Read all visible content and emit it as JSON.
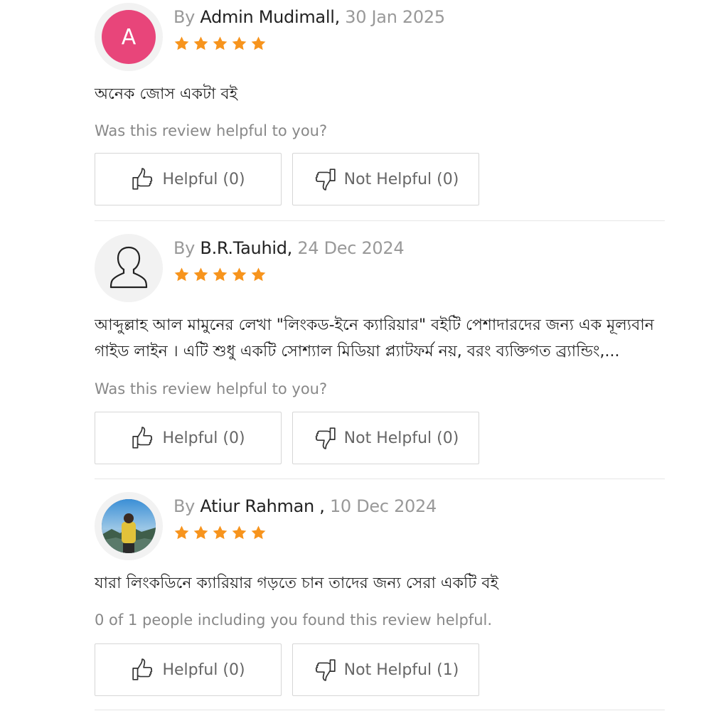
{
  "reviews": [
    {
      "by_label": "By ",
      "author": "Admin Mudimall,",
      "date": " 30 Jan 2025",
      "avatar_letter": "A",
      "avatar_type": "letter",
      "rating": 5,
      "text": "অনেক জোস একটা বই",
      "helpful_question": "Was this review helpful to you?",
      "helpful_label": "Helpful (0)",
      "not_helpful_label": "Not Helpful (0)"
    },
    {
      "by_label": "By ",
      "author": "B.R.Tauhid,",
      "date": " 24 Dec 2024",
      "avatar_type": "user-icon",
      "rating": 5,
      "text": "আব্দুল্লাহ আল মামুনের লেখা \"লিংকড-ইনে ক্যারিয়ার\" বইটি পেশাদারদের জন্য এক মূল্যবান গাইড লাইন । এটি শুধু একটি সোশ্যাল মিডিয়া প্ল্যাটফর্ম নয়, বরং ব্যক্তিগত ব্র্যান্ডিং,...",
      "helpful_question": "Was this review helpful to you?",
      "helpful_label": "Helpful (0)",
      "not_helpful_label": "Not Helpful (0)"
    },
    {
      "by_label": "By ",
      "author": "Atiur Rahman ,",
      "date": " 10 Dec 2024",
      "avatar_type": "photo",
      "rating": 5,
      "text": "যারা লিংকডিনে ক্যারিয়ার গড়তে চান তাদের জন্য সেরা একটি বই",
      "helpful_question": "0 of 1 people including you found this review helpful.",
      "helpful_label": "Helpful (0)",
      "not_helpful_label": "Not Helpful (1)"
    }
  ],
  "colors": {
    "star": "#f7941d",
    "avatar_letter_bg": "#e8457a",
    "author_text": "#222222",
    "muted_text": "#999999",
    "border": "#d6d6d6"
  },
  "icons": {
    "star": "star-icon",
    "thumbs_up": "thumbs-up-icon",
    "thumbs_down": "thumbs-down-icon",
    "user": "user-icon"
  }
}
